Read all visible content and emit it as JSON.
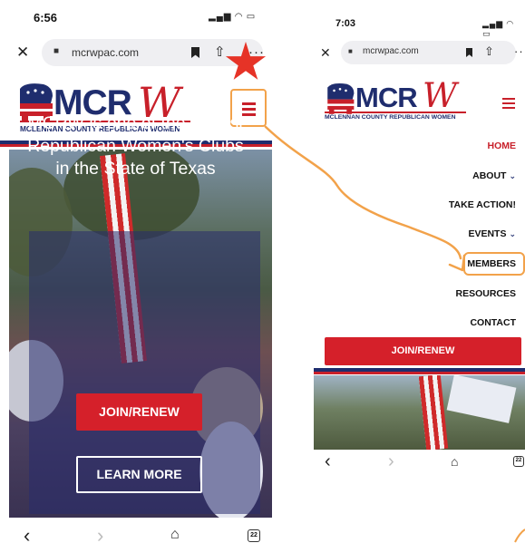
{
  "left_screen": {
    "status_time": "6:56",
    "status_icons": "▂▄▆ ◠ ▭",
    "close_glyph": "✕",
    "url": "mcrwpac.com",
    "more_glyph": "···",
    "logo": {
      "mcr": "MCR",
      "w": "W",
      "subtitle": "MCLENNAN COUNTY REPUBLICAN WOMEN"
    },
    "hero_text": "MCRW is one of the largest Republican Women's Clubs in the State of Texas",
    "join_button": "JOIN/RENEW",
    "learn_button": "LEARN MORE",
    "nav": {
      "back": "‹",
      "forward": "›",
      "home": "⌂",
      "tabs_count": "22"
    }
  },
  "right_screen": {
    "status_time": "7:03",
    "status_icons": "▂▄▆ ◠ ▭",
    "close_glyph": "✕",
    "url": "mcrwpac.com",
    "more_glyph": "··",
    "logo": {
      "mcr": "MCR",
      "w": "W",
      "subtitle": "MCLENNAN COUNTY REPUBLICAN WOMEN"
    },
    "menu": [
      {
        "label": "HOME",
        "chevron": ""
      },
      {
        "label": "ABOUT",
        "chevron": "⌄"
      },
      {
        "label": "TAKE ACTION!",
        "chevron": ""
      },
      {
        "label": "EVENTS",
        "chevron": "⌄"
      },
      {
        "label": "MEMBERS",
        "chevron": ""
      },
      {
        "label": "RESOURCES",
        "chevron": ""
      },
      {
        "label": "CONTACT",
        "chevron": ""
      }
    ],
    "join_button": "JOIN/RENEW",
    "nav": {
      "back": "‹",
      "forward": "›",
      "home": "⌂",
      "tabs_count": "22"
    }
  },
  "colors": {
    "brand_red": "#c8202a",
    "brand_blue": "#1f2d6e",
    "annotation_orange": "#f2a24a",
    "star_red": "#e63327"
  },
  "icons": [
    "close-icon",
    "lock-icon",
    "bookmark-icon",
    "share-icon",
    "more-icon",
    "hamburger-icon",
    "star-annotation-icon",
    "back-icon",
    "forward-icon",
    "home-icon",
    "tabs-icon",
    "chevron-down-icon"
  ]
}
